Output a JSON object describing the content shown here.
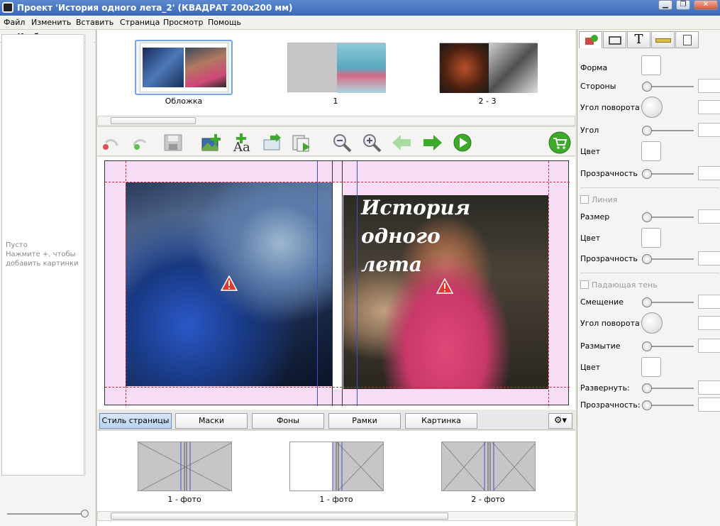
{
  "window": {
    "title": "Проект 'История одного лета_2' (КВАДРАТ 200x200 мм)"
  },
  "menu": [
    "Файл",
    "Изменить",
    "Вставить",
    "Страница",
    "Просмотр",
    "Помощь"
  ],
  "left_panel": {
    "header": "Изображения",
    "add_label": "+",
    "empty_text": [
      "Пусто",
      "Нажмите +, чтобы",
      "добавить картинки"
    ]
  },
  "pages": [
    {
      "label": "Обложка"
    },
    {
      "label": "1"
    },
    {
      "label": "2 - 3"
    }
  ],
  "cover_text": [
    "История",
    "одного",
    "лета"
  ],
  "tabs": [
    "Стиль страницы",
    "Маски",
    "Фоны",
    "Рамки",
    "Картинка"
  ],
  "layouts": [
    {
      "label": "1 - фото"
    },
    {
      "label": "1 - фото"
    },
    {
      "label": "2 - фото"
    }
  ],
  "properties": {
    "shape": "Форма",
    "sides": "Стороны",
    "rotation_angle": "Угол поворота",
    "angle": "Угол",
    "color": "Цвет",
    "opacity": "Прозрачность",
    "line_section": "Линия",
    "line_size": "Размер",
    "line_color": "Цвет",
    "line_opacity": "Прозрачность",
    "shadow_section": "Падающая тень",
    "shadow_offset": "Смещение",
    "shadow_rotation": "Угол поворота",
    "shadow_blur": "Размытие",
    "shadow_color": "Цвет",
    "shadow_expand": "Развернуть:",
    "shadow_opacity": "Прозрачность:"
  },
  "icons": [
    "app-icon",
    "minimize-icon",
    "maximize-icon",
    "close-icon",
    "add-icon",
    "gear-icon",
    "undo-icon",
    "redo-icon",
    "save-icon",
    "add-image-icon",
    "add-text-icon",
    "import-icon",
    "export-icon",
    "zoom-out-icon",
    "zoom-in-icon",
    "arrow-left-icon",
    "arrow-right-icon",
    "play-icon",
    "cart-icon",
    "warning-icon",
    "shape-tab-icon",
    "frame-tab-icon",
    "text-tab-icon",
    "ruler-tab-icon",
    "page-tab-icon"
  ],
  "colors": {
    "accent_green": "#3daa2a",
    "spread_bg": "#f6dcf4",
    "warning": "#e03a2a",
    "guide": "#c0303a"
  }
}
